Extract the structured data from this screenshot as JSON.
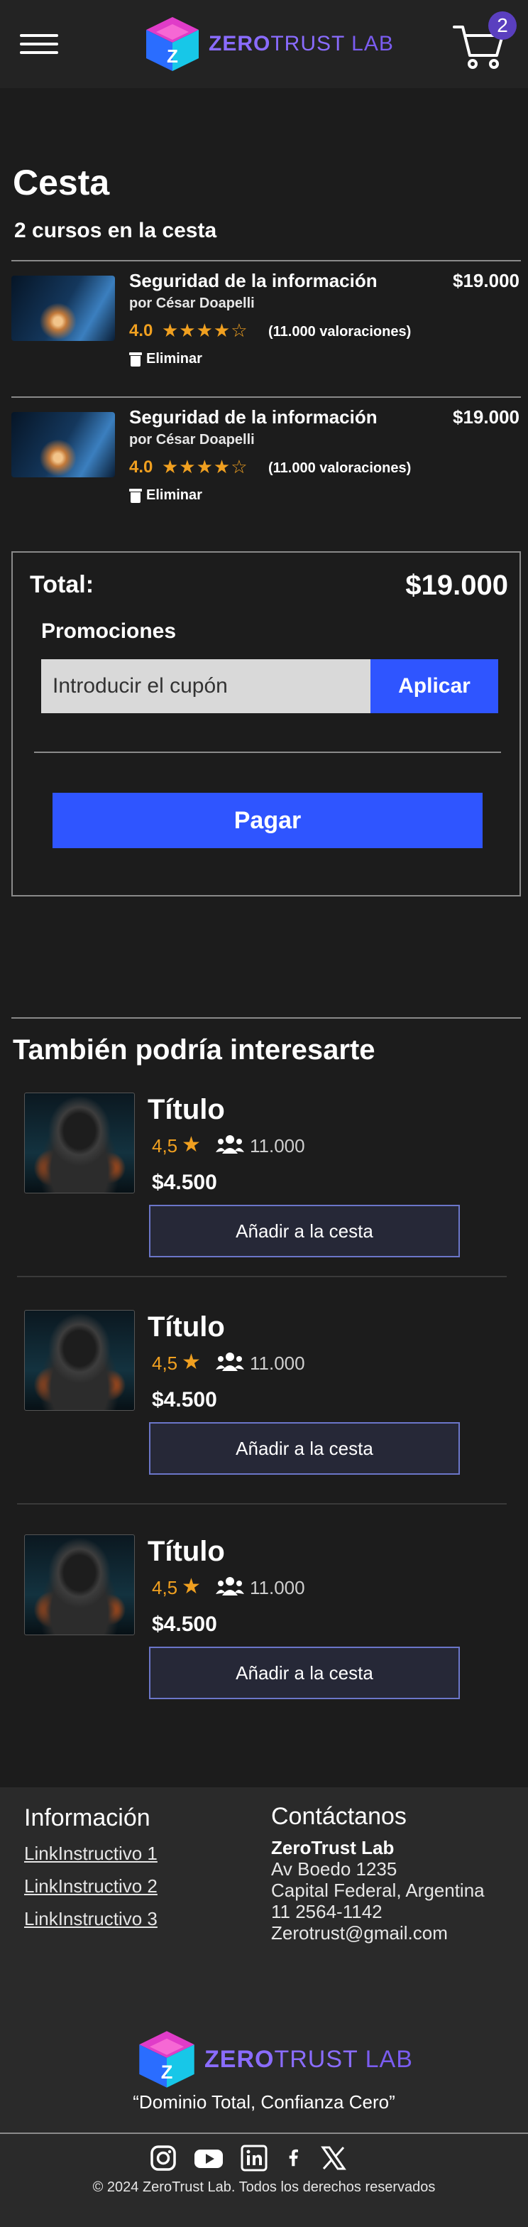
{
  "header": {
    "brand_zero": "ZERO",
    "brand_trust": "TRUST",
    "brand_lab": " LAB",
    "cart_count": "2"
  },
  "cart": {
    "title": "Cesta",
    "count_label": "2 cursos en la cesta",
    "items": [
      {
        "title": "Seguridad de la información",
        "author": "por César Doapelli",
        "rating": "4.0",
        "stars": "★★★★☆",
        "reviews": "(11.000 valoraciones)",
        "remove_label": "Eliminar",
        "price": "$19.000"
      },
      {
        "title": "Seguridad de la información",
        "author": "por César Doapelli",
        "rating": "4.0",
        "stars": "★★★★☆",
        "reviews": "(11.000 valoraciones)",
        "remove_label": "Eliminar",
        "price": "$19.000"
      }
    ]
  },
  "summary": {
    "total_label": "Total:",
    "total_value": "$19.000",
    "promo_label": "Promociones",
    "coupon_placeholder": "Introducir el cupón",
    "apply_label": "Aplicar",
    "pay_label": "Pagar"
  },
  "recommendations": {
    "title": "También podría interesarte",
    "items": [
      {
        "name": "Título",
        "rating": "4,5",
        "students": "11.000",
        "price": "$4.500",
        "add_label": "Añadir a la cesta"
      },
      {
        "name": "Título",
        "rating": "4,5",
        "students": "11.000",
        "price": "$4.500",
        "add_label": "Añadir a la cesta"
      },
      {
        "name": "Título",
        "rating": "4,5",
        "students": "11.000",
        "price": "$4.500",
        "add_label": "Añadir a la cesta"
      }
    ]
  },
  "footer": {
    "info_title": "Información",
    "links": [
      "LinkInstructivo 1",
      "LinkInstructivo 2",
      "LinkInstructivo 3"
    ],
    "contact_title": "Contáctanos",
    "contact_name": "ZeroTrust Lab",
    "contact_address": "Av Boedo 1235",
    "contact_city": "Capital Federal, Argentina",
    "contact_phone": "11 2564-1142",
    "contact_email": "Zerotrust@gmail.com",
    "tagline": "“Dominio Total, Confianza Cero”",
    "copyright": "© 2024 ZeroTrust Lab. Todos los derechos reservados",
    "socials": [
      "instagram-icon",
      "youtube-icon",
      "linkedin-icon",
      "facebook-icon",
      "x-icon"
    ]
  },
  "colors": {
    "background": "#1c1c1c",
    "header": "#232323",
    "accent_blue": "#2f55ff",
    "rating_orange": "#f0a020",
    "brand_purple": "#8a6cff",
    "badge": "#5a3fbf"
  }
}
